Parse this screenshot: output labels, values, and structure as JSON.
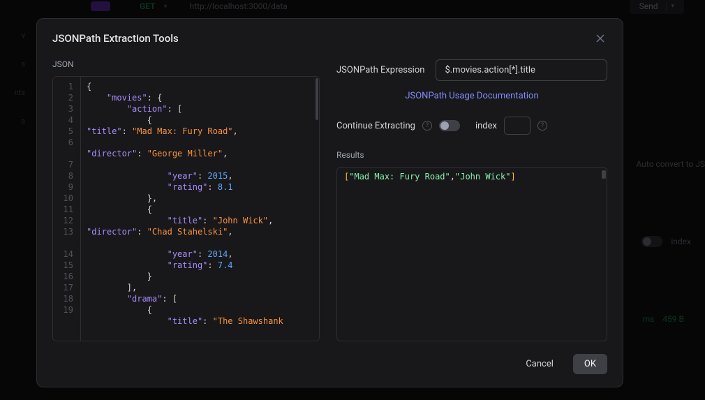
{
  "background": {
    "method": "GET",
    "url": "http://localhost:3000/data",
    "send": "Send",
    "autoConvert": "Auto convert to JS",
    "indexLabel": "index",
    "responseMs": "ms",
    "responseSize": "459 B",
    "sidebar": [
      "v",
      "s",
      "nts",
      "s"
    ]
  },
  "modal": {
    "title": "JSONPath Extraction Tools",
    "jsonLabel": "JSON",
    "jsonSource": {
      "movies": {
        "action": [
          {
            "title": "Mad Max: Fury Road",
            "director": "George Miller",
            "year": 2015,
            "rating": 8.1
          },
          {
            "title": "John Wick",
            "director": "Chad Stahelski",
            "year": 2014,
            "rating": 7.4
          }
        ],
        "drama": [
          {
            "title": "The Shawshank"
          }
        ]
      }
    },
    "expression": {
      "label": "JSONPath Expression",
      "value": "$.movies.action[*].title"
    },
    "docLink": "JSONPath Usage Documentation",
    "continueLabel": "Continue Extracting",
    "indexLabel": "index",
    "indexValue": "",
    "resultsLabel": "Results",
    "resultsValues": [
      "Mad Max: Fury Road",
      "John Wick"
    ],
    "buttons": {
      "cancel": "Cancel",
      "ok": "OK"
    }
  },
  "chart_data": null
}
